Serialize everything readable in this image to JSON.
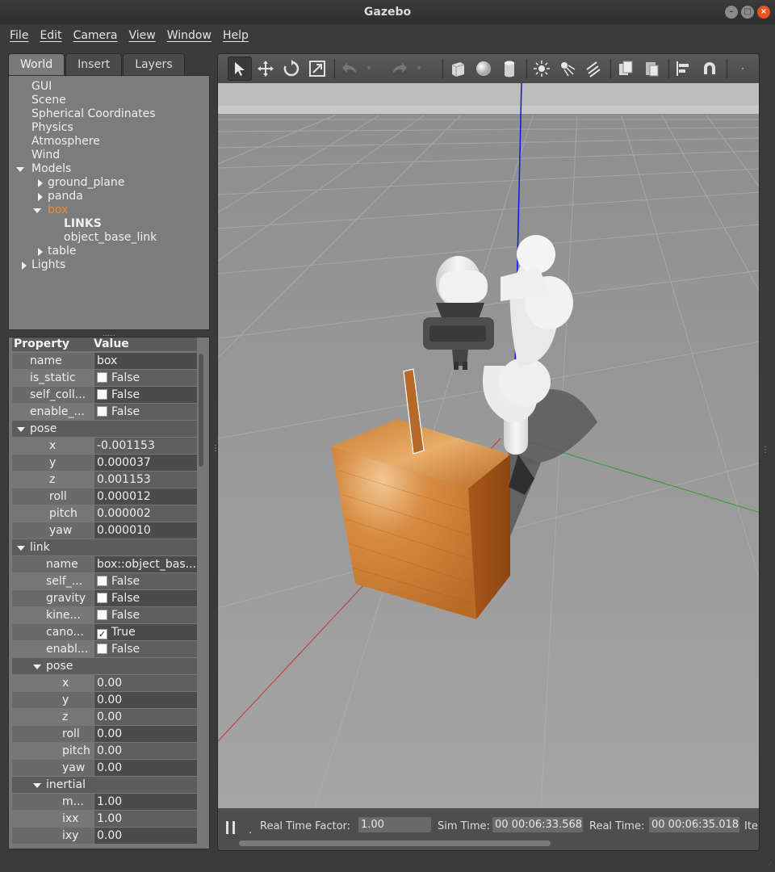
{
  "window": {
    "title": "Gazebo"
  },
  "menubar": [
    "File",
    "Edit",
    "Camera",
    "View",
    "Window",
    "Help"
  ],
  "tabs": [
    "World",
    "Insert",
    "Layers"
  ],
  "tree": {
    "gui": "GUI",
    "scene": "Scene",
    "spherical": "Spherical Coordinates",
    "physics": "Physics",
    "atmosphere": "Atmosphere",
    "wind": "Wind",
    "models": "Models",
    "ground_plane": "ground_plane",
    "panda": "panda",
    "box": "box",
    "links": "LINKS",
    "object_base_link": "object_base_link",
    "table": "table",
    "lights": "Lights"
  },
  "props": {
    "header_property": "Property",
    "header_value": "Value",
    "rows": [
      {
        "k": "name",
        "v": "box"
      },
      {
        "k": "is_static",
        "v": "False",
        "check": false
      },
      {
        "k": "self_coll...",
        "v": "False",
        "check": false
      },
      {
        "k": "enable_...",
        "v": "False",
        "check": false
      },
      {
        "k": "pose",
        "section": true
      },
      {
        "k": "x",
        "v": "-0.001153"
      },
      {
        "k": "y",
        "v": "0.000037"
      },
      {
        "k": "z",
        "v": "0.001153"
      },
      {
        "k": "roll",
        "v": "0.000012"
      },
      {
        "k": "pitch",
        "v": "0.000002"
      },
      {
        "k": "yaw",
        "v": "0.000010"
      },
      {
        "k": "link",
        "section": true
      },
      {
        "k": "name",
        "v": "box::object_bas..."
      },
      {
        "k": "self_...",
        "v": "False",
        "check": false
      },
      {
        "k": "gravity",
        "v": "False",
        "check": false
      },
      {
        "k": "kine...",
        "v": "False",
        "check": false
      },
      {
        "k": "cano...",
        "v": "True",
        "check": true
      },
      {
        "k": "enabl...",
        "v": "False",
        "check": false
      },
      {
        "k": "pose",
        "section": true
      },
      {
        "k": "x",
        "v": "0.00"
      },
      {
        "k": "y",
        "v": "0.00"
      },
      {
        "k": "z",
        "v": "0.00"
      },
      {
        "k": "roll",
        "v": "0.00"
      },
      {
        "k": "pitch",
        "v": "0.00"
      },
      {
        "k": "yaw",
        "v": "0.00"
      },
      {
        "k": "inertial",
        "section": true
      },
      {
        "k": "m...",
        "v": "1.00"
      },
      {
        "k": "ixx",
        "v": "1.00"
      },
      {
        "k": "ixy",
        "v": "0.00"
      }
    ]
  },
  "status": {
    "rtf_label": "Real Time Factor:",
    "rtf_value": "1.00",
    "sim_label": "Sim Time:",
    "sim_value": "00 00:06:33.568",
    "real_label": "Real Time:",
    "real_value": "00 00:06:35.018",
    "iter_label": "Ite",
    "step_label": "."
  },
  "colors": {
    "selected": "#f58a2e",
    "ground": "#9a9a9a",
    "sky": "#bfbfbf"
  }
}
